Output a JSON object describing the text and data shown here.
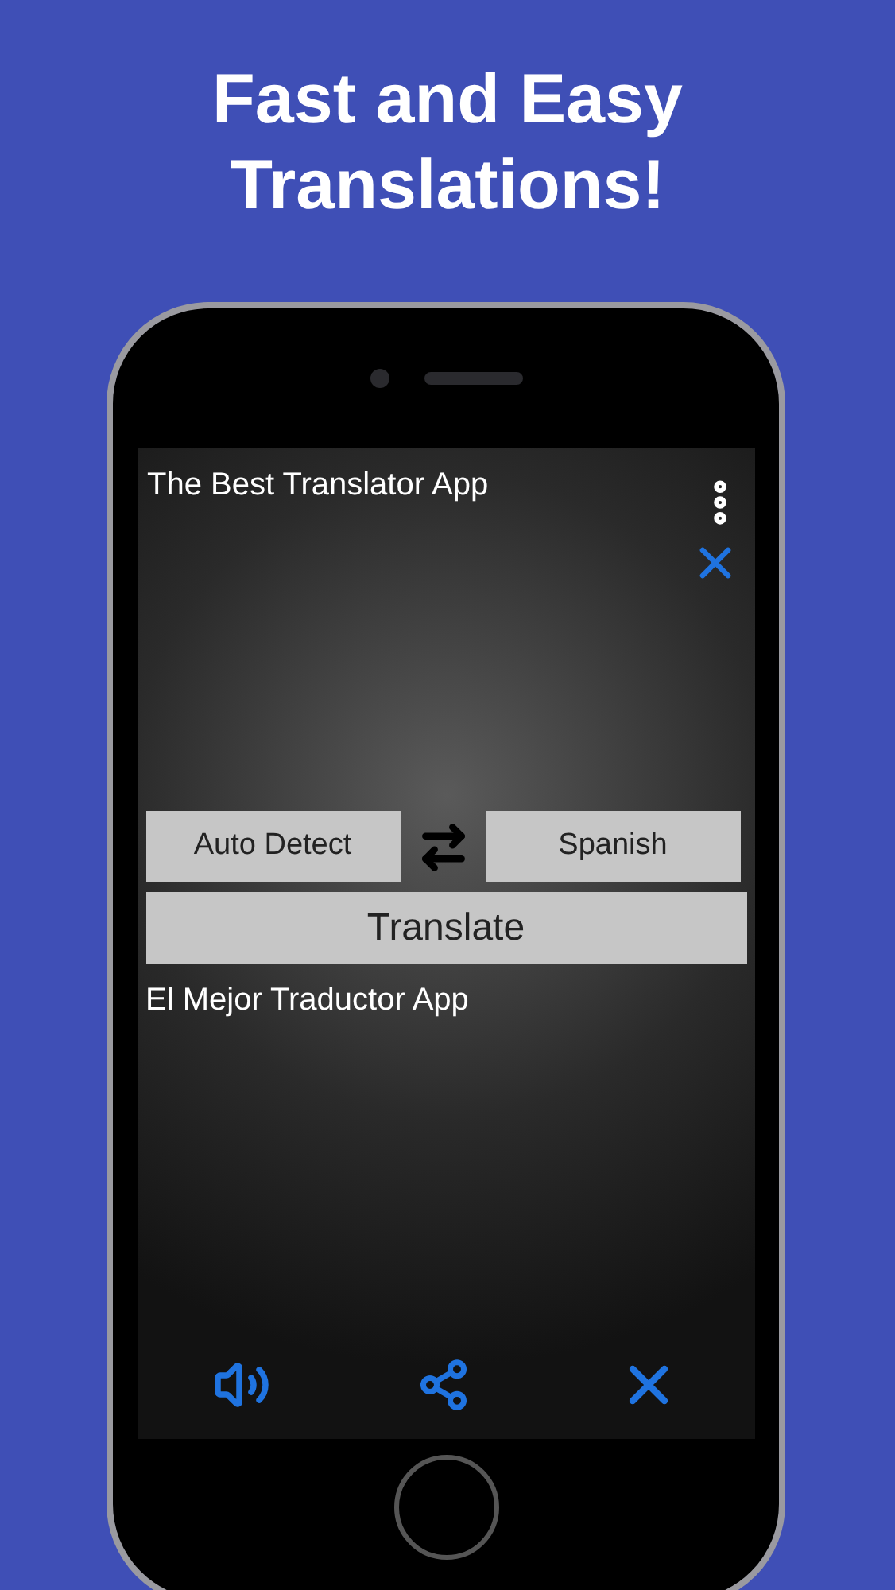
{
  "headline": [
    "Fast and Easy",
    "Translations!"
  ],
  "app": {
    "input_text": "The Best Translator App",
    "source_language": "Auto Detect",
    "target_language": "Spanish",
    "translate_button": "Translate",
    "output_text": "El Mejor Traductor App"
  }
}
